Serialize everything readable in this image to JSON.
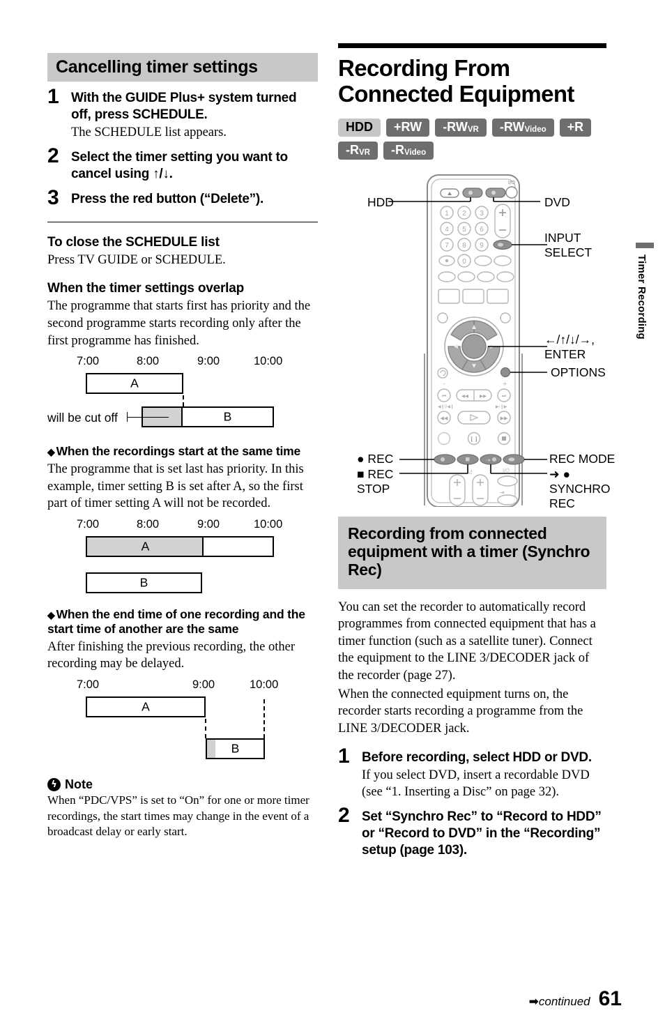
{
  "left": {
    "section_title": "Cancelling timer settings",
    "steps": [
      {
        "num": "1",
        "head": "With the GUIDE Plus+ system turned off, press SCHEDULE.",
        "sub": "The SCHEDULE list appears."
      },
      {
        "num": "2",
        "head": "Select the timer setting you want to cancel using ↑/↓.",
        "sub": ""
      },
      {
        "num": "3",
        "head": "Press the red button (“Delete”).",
        "sub": ""
      }
    ],
    "close_head": "To close the SCHEDULE list",
    "close_body": "Press TV GUIDE or SCHEDULE.",
    "overlap_head": "When the timer settings overlap",
    "overlap_body": "The programme that starts first has priority and the second programme starts recording only after the first programme has finished.",
    "same_start_head": "When the recordings start at the same time",
    "same_start_body": "The programme that is set last has priority. In this example, timer setting B is set after A, so the first part of timer setting A will not be recorded.",
    "same_end_head": "When the end time of one recording and the start time of another are the same",
    "same_end_body": "After finishing the previous recording, the other recording may be delayed.",
    "cutoff_label": "will be cut off",
    "note_head": "Note",
    "note_body": "When “PDC/VPS” is set to “On” for one or more timer recordings, the start times may change in the event of a broadcast delay or early start."
  },
  "diagrams": [
    {
      "name": "overlap",
      "ticks": [
        "7:00",
        "8:00",
        "9:00",
        "10:00"
      ],
      "bars": [
        {
          "label": "A",
          "start": "7:00",
          "end": "8:30",
          "shaded": false
        },
        {
          "label": "B",
          "start": "8:05",
          "end": "9:50",
          "shaded_until": "8:30"
        }
      ]
    },
    {
      "name": "same-start",
      "ticks": [
        "7:00",
        "8:00",
        "9:00",
        "10:00"
      ],
      "bars": [
        {
          "label": "A",
          "start": "7:00",
          "end": "10:00",
          "shaded_until": "9:00"
        },
        {
          "label": "B",
          "start": "7:00",
          "end": "9:00",
          "shaded": false
        }
      ]
    },
    {
      "name": "same-end",
      "ticks": [
        "7:00",
        "9:00",
        "10:00"
      ],
      "bars": [
        {
          "label": "A",
          "start": "7:00",
          "end": "9:00",
          "shaded": false
        },
        {
          "label": "B",
          "start": "9:00",
          "end": "10:00",
          "shaded_until": "9:05"
        }
      ]
    }
  ],
  "right": {
    "title": "Recording From Connected Equipment",
    "badges_row1": [
      {
        "text": "HDD",
        "style": "light"
      },
      {
        "text": "+RW",
        "style": "dark"
      },
      {
        "text": "-RW",
        "sub": "VR",
        "style": "dark"
      },
      {
        "text": "-RW",
        "sub": "Video",
        "style": "dark"
      },
      {
        "text": "+R",
        "style": "dark"
      }
    ],
    "badges_row2": [
      {
        "text": "-R",
        "sub": "VR",
        "style": "dark"
      },
      {
        "text": "-R",
        "sub": "Video",
        "style": "dark"
      }
    ],
    "remote_callouts": {
      "hdd": "HDD",
      "dvd": "DVD",
      "input_select_l1": "INPUT",
      "input_select_l2": "SELECT",
      "arrows": "←/↑/↓/→,",
      "enter": "ENTER",
      "options": "OPTIONS",
      "rec": "● REC",
      "rec_stop_l1": "■ REC",
      "rec_stop_l2": "STOP",
      "rec_mode": "REC MODE",
      "synchro_arrow": "➜ ●",
      "synchro_l1": "SYNCHRO",
      "synchro_l2": "REC"
    },
    "section_title": "Recording from connected equipment with a timer (Synchro Rec)",
    "body": "You can set the recorder to automatically record programmes from connected equipment that has a timer function (such as a satellite tuner). Connect the equipment to the LINE 3/DECODER jack of the recorder (page 27).",
    "body2": "When the connected equipment turns on, the recorder starts recording a programme from the LINE 3/DECODER jack.",
    "steps": [
      {
        "num": "1",
        "head": "Before recording, select HDD or DVD.",
        "sub": "If you select DVD, insert a recordable DVD (see “1. Inserting a Disc” on page 32)."
      },
      {
        "num": "2",
        "head": "Set “Synchro Rec” to “Record to HDD” or “Record to DVD” in the “Recording” setup (page 103).",
        "sub": ""
      }
    ]
  },
  "side_tab": {
    "label": "Timer Recording"
  },
  "footer": {
    "continued": "continued",
    "page": "61"
  }
}
